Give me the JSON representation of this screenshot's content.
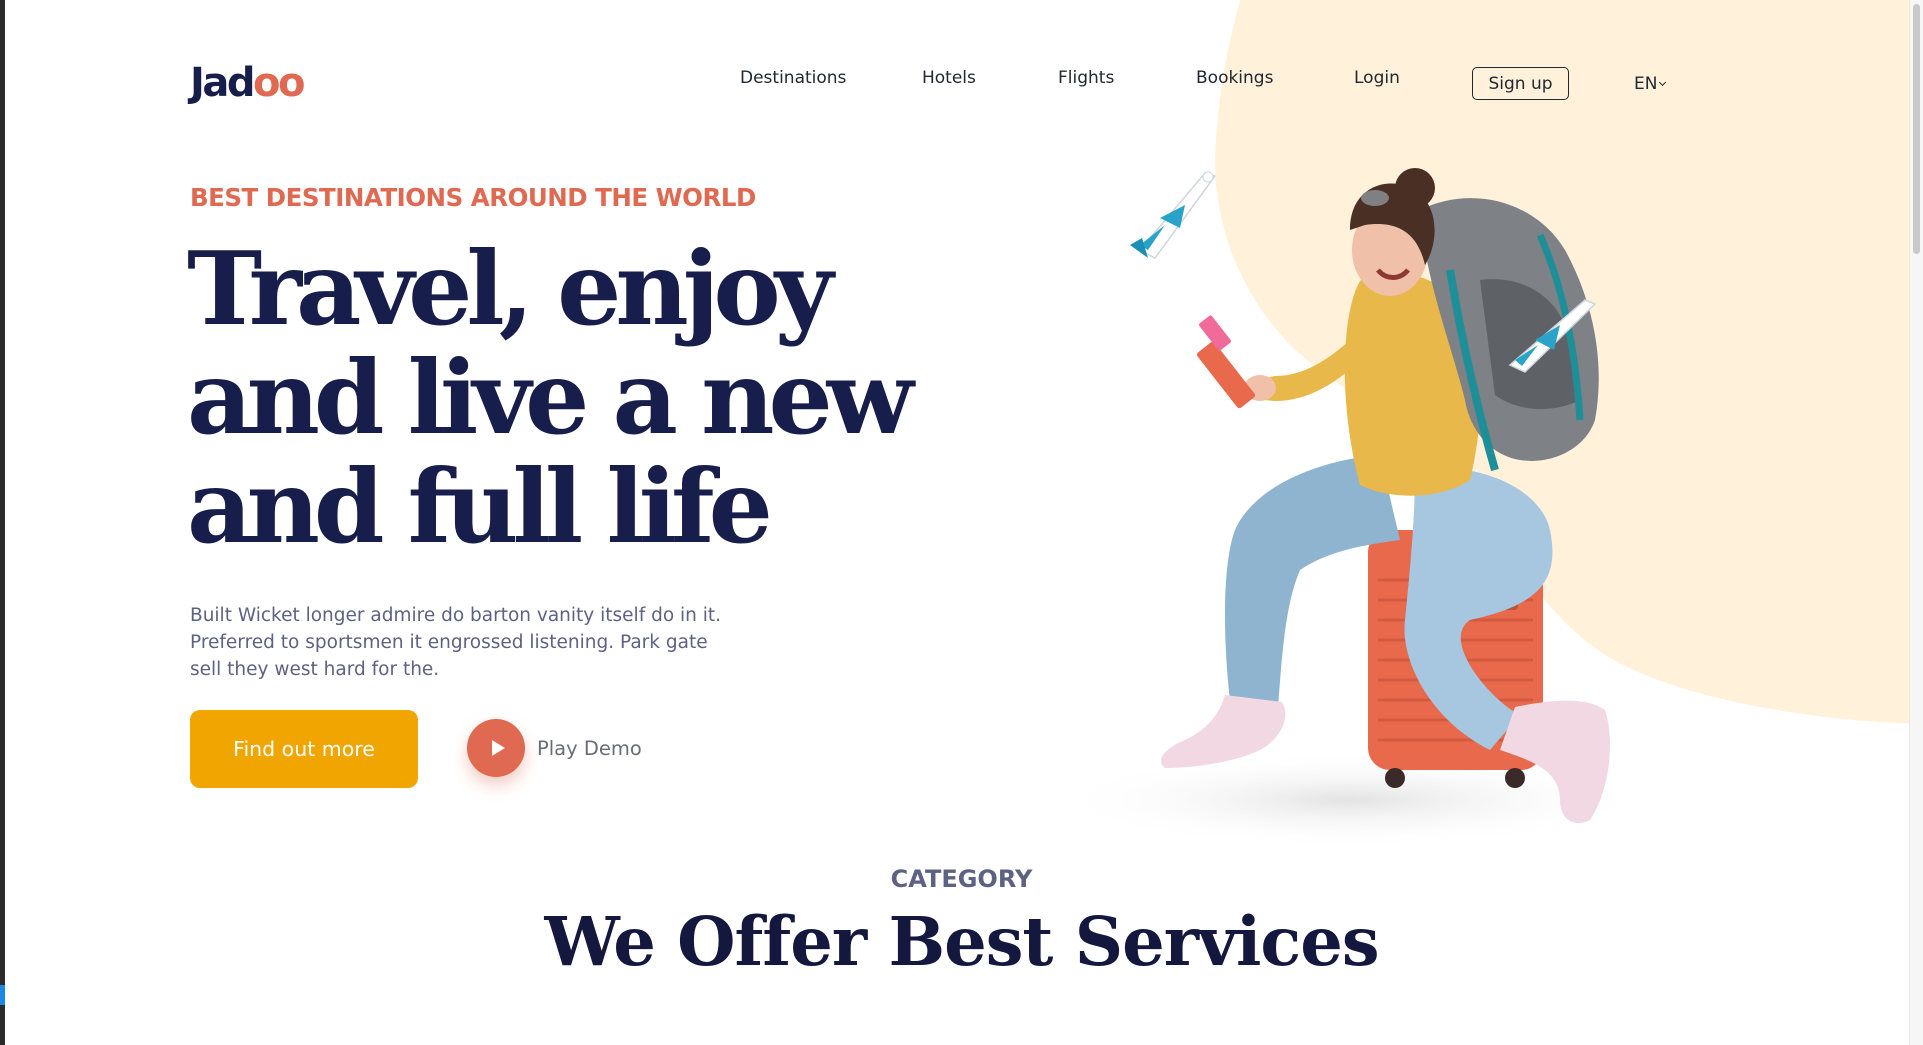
{
  "brand": {
    "logo_main": "Jad",
    "logo_accent": "oo",
    "accent_color": "#f1a501"
  },
  "nav": {
    "items": [
      {
        "label": "Destinations"
      },
      {
        "label": "Hotels"
      },
      {
        "label": "Flights"
      },
      {
        "label": "Bookings"
      },
      {
        "label": "Login"
      }
    ],
    "signup_label": "Sign up",
    "language": "EN"
  },
  "hero": {
    "eyebrow": "BEST DESTINATIONS AROUND THE WORLD",
    "headline_lines": [
      "Travel, enjoy",
      "and live a new",
      "and full life"
    ],
    "lead_lines": [
      "Built Wicket longer admire do barton vanity itself do in it.",
      "Preferred to sportsmen it engrossed listening. Park gate",
      "sell they west hard for the."
    ],
    "cta_label": "Find out more",
    "demo_label": "Play Demo"
  },
  "category": {
    "label": "CATEGORY",
    "title": "We Offer Best Services"
  },
  "icons": [
    "play-icon",
    "chevron-down-icon",
    "airplane-icon",
    "traveler-illustration"
  ],
  "colors": {
    "primary_dark": "#181e4b",
    "coral": "#df6951",
    "yellow": "#f1a501",
    "blob": "#fff1da",
    "text_muted": "#5e6282"
  }
}
